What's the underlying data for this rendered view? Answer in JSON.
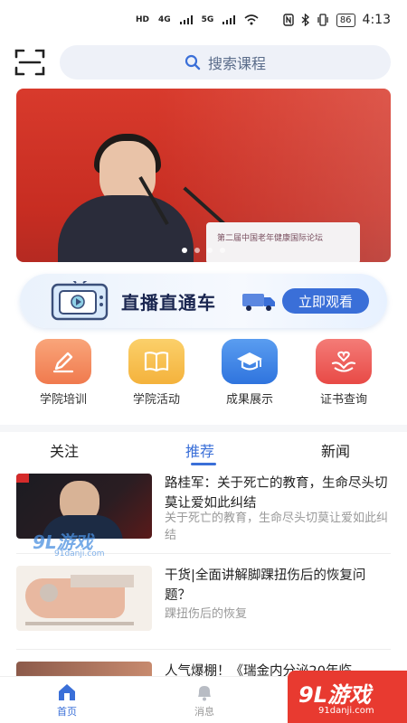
{
  "status_bar": {
    "network_left": "HD",
    "signal1": "4G",
    "signal2": "5G",
    "battery": "86",
    "time": "4:13"
  },
  "header": {
    "search_placeholder": "搜索课程"
  },
  "banner": {
    "lectern_text": "第二届中国老年健康国际论坛",
    "page_count": 4,
    "active_index": 0
  },
  "live_banner": {
    "title": "直播直通车",
    "button": "立即观看"
  },
  "quick_nav": [
    {
      "label": "学院培训",
      "icon": "pencil-icon",
      "color": "#f4875a"
    },
    {
      "label": "学院活动",
      "icon": "book-icon",
      "color": "#f6b945"
    },
    {
      "label": "成果展示",
      "icon": "graduation-cap-icon",
      "color": "#3f86e6"
    },
    {
      "label": "证书查询",
      "icon": "hands-heart-icon",
      "color": "#ef5a55"
    }
  ],
  "tabs": [
    {
      "label": "关注"
    },
    {
      "label": "推荐"
    },
    {
      "label": "新闻"
    }
  ],
  "articles": [
    {
      "title": "路桂军：关于死亡的教育，生命尽头切莫让爱如此纠结",
      "subtitle": "关于死亡的教育，生命尽头切莫让爱如此纠结"
    },
    {
      "title": "干货|全面讲解脚踝扭伤后的恢复问题？",
      "subtitle": "踝扭伤后的恢复"
    },
    {
      "title": "人气爆棚！《瑞金内分泌20年临",
      "subtitle": ""
    }
  ],
  "watermark": {
    "main": "9L游戏",
    "sub": "91danji.com"
  },
  "bottom_nav": [
    {
      "label": "首页",
      "active": true
    },
    {
      "label": "消息",
      "active": false
    }
  ],
  "corner_logo": {
    "main": "9L游戏",
    "sub": "91danji.com"
  },
  "colors": {
    "accent": "#3a6fd8",
    "banner_red": "#d83a2c"
  }
}
